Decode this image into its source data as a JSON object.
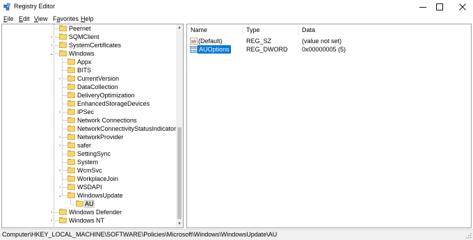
{
  "window": {
    "title": "Registry Editor",
    "minimize_glyph": "—",
    "maximize_glyph": "☐",
    "close_glyph": "✕"
  },
  "menu": [
    {
      "key": "F",
      "rest": "ile"
    },
    {
      "key": "E",
      "rest": "dit"
    },
    {
      "key": "V",
      "rest": "iew"
    },
    {
      "key": "a",
      "prefix": "F",
      "rest": "vorites"
    },
    {
      "key": "H",
      "rest": "elp"
    }
  ],
  "tree": {
    "items": [
      {
        "label": "Peernet",
        "chevron": ""
      },
      {
        "label": "SQMClient",
        "chevron": "›"
      },
      {
        "label": "SystemCertificates",
        "chevron": "›"
      },
      {
        "label": "Windows",
        "chevron": "⌄"
      },
      {
        "label": "Appx",
        "chevron": ""
      },
      {
        "label": "BITS",
        "chevron": ""
      },
      {
        "label": "CurrentVersion",
        "chevron": "›"
      },
      {
        "label": "DataCollection",
        "chevron": ""
      },
      {
        "label": "DeliveryOptimization",
        "chevron": ""
      },
      {
        "label": "EnhancedStorageDevices",
        "chevron": ""
      },
      {
        "label": "IPSec",
        "chevron": "›"
      },
      {
        "label": "Network Connections",
        "chevron": ""
      },
      {
        "label": "NetworkConnectivityStatusIndicator",
        "chevron": ""
      },
      {
        "label": "NetworkProvider",
        "chevron": "›"
      },
      {
        "label": "safer",
        "chevron": "›"
      },
      {
        "label": "SettingSync",
        "chevron": ""
      },
      {
        "label": "System",
        "chevron": ""
      },
      {
        "label": "WcmSvc",
        "chevron": "›"
      },
      {
        "label": "WorkplaceJoin",
        "chevron": ""
      },
      {
        "label": "WSDAPI",
        "chevron": "›"
      },
      {
        "label": "WindowsUpdate",
        "chevron": "⌄"
      },
      {
        "label": "AU",
        "chevron": "",
        "selected": true
      },
      {
        "label": "Windows Defender",
        "chevron": "›"
      },
      {
        "label": "Windows NT",
        "chevron": "›"
      }
    ]
  },
  "list": {
    "columns": {
      "name": "Name",
      "type": "Type",
      "data": "Data"
    },
    "rows": [
      {
        "name": "(Default)",
        "type": "REG_SZ",
        "data": "(value not set)",
        "icon": "string-value-icon"
      },
      {
        "name": "AUOptions",
        "type": "REG_DWORD",
        "data": "0x00000005 (5)",
        "icon": "binary-value-icon",
        "selected": true
      }
    ]
  },
  "status": {
    "path": "Computer\\HKEY_LOCAL_MACHINE\\SOFTWARE\\Policies\\Microsoft\\Windows\\WindowsUpdate\\AU"
  },
  "colors": {
    "selection": "#0078d7",
    "tree_selection": "#d9d9d9",
    "folder": "#f6d477"
  }
}
